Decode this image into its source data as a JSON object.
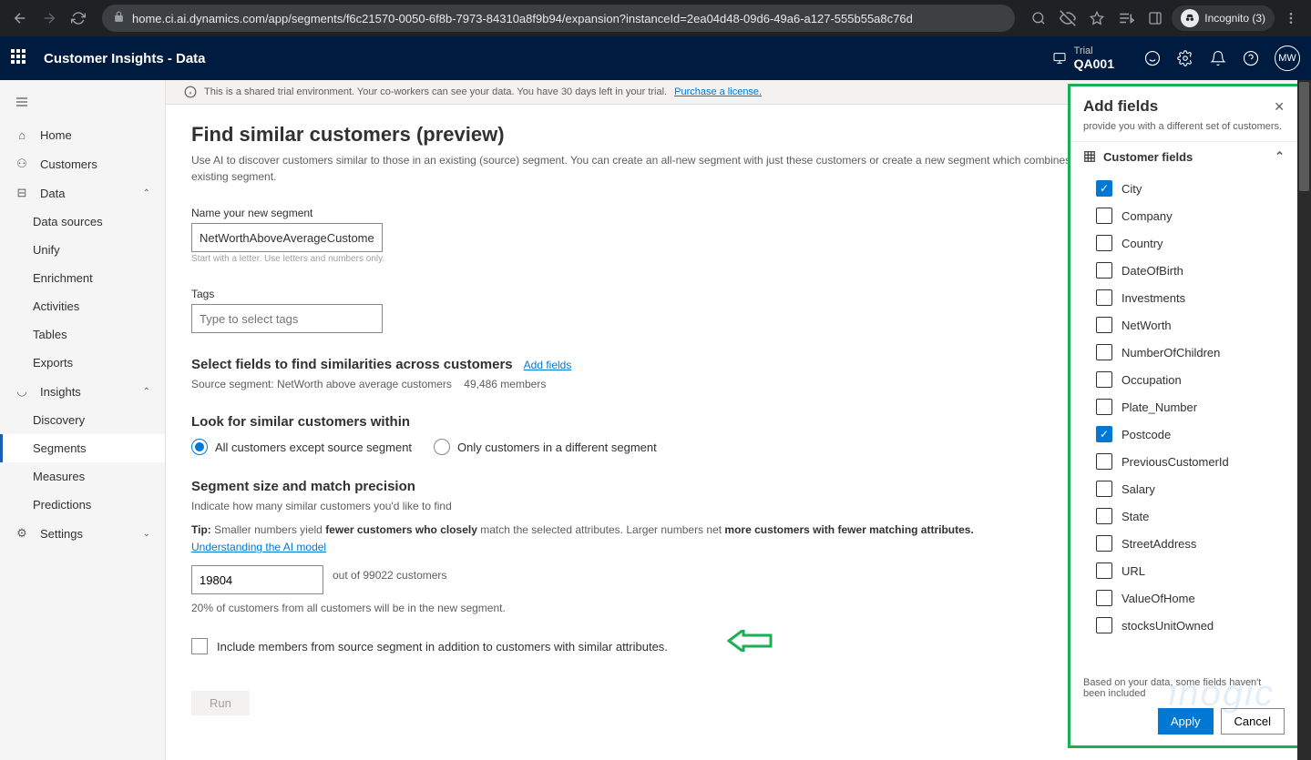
{
  "browser": {
    "url": "home.ci.ai.dynamics.com/app/segments/f6c21570-0050-6f8b-7973-84310a8f9b94/expansion?instanceId=2ea04d48-09d6-49a6-a127-555b55a8c76d",
    "incognito": "Incognito (3)"
  },
  "header": {
    "title": "Customer Insights - Data",
    "trial_label": "Trial",
    "trial_env": "QA001",
    "avatar": "MW"
  },
  "nav": {
    "home": "Home",
    "customers": "Customers",
    "data": "Data",
    "data_sources": "Data sources",
    "unify": "Unify",
    "enrichment": "Enrichment",
    "activities": "Activities",
    "tables": "Tables",
    "exports": "Exports",
    "insights": "Insights",
    "discovery": "Discovery",
    "segments": "Segments",
    "measures": "Measures",
    "predictions": "Predictions",
    "settings": "Settings"
  },
  "banner": {
    "text": "This is a shared trial environment. Your co-workers can see your data. You have 30 days left in your trial.",
    "link": "Purchase a license."
  },
  "page": {
    "title": "Find similar customers (preview)",
    "desc": "Use AI to discover customers similar to those in an existing (source) segment. You can create an all-new segment with just these customers or create a new segment which combines newly discovered customers with the existing segment.",
    "name_label": "Name your new segment",
    "name_value": "NetWorthAboveAverageCustomersEx...",
    "name_hint": "Start with a letter. Use letters and numbers only.",
    "tags_label": "Tags",
    "tags_placeholder": "Type to select tags",
    "select_fields_title": "Select fields to find similarities across customers",
    "add_fields_link": "Add fields",
    "source_segment": "Source segment: NetWorth above average customers",
    "source_members": "49,486 members",
    "look_for_title": "Look for similar customers within",
    "radio1": "All customers except source segment",
    "radio2": "Only customers in a different segment",
    "size_title": "Segment size and match precision",
    "size_sub": "Indicate how many similar customers you'd like to find",
    "tip_label": "Tip:",
    "tip1": "Smaller numbers yield",
    "tip_b1": "fewer customers who closely",
    "tip2": "match the selected attributes. Larger numbers net",
    "tip_b2": "more customers with fewer matching attributes.",
    "tip_link": "Understanding the AI model",
    "size_value": "19804",
    "size_suffix": "out of 99022 customers",
    "size_pct": "20% of customers from all customers will be in the new segment.",
    "include_label": "Include members from source segment in addition to customers with similar attributes.",
    "run": "Run"
  },
  "panel": {
    "title": "Add fields",
    "note": "provide you with a different set of customers.",
    "section": "Customer fields",
    "fields": [
      {
        "label": "City",
        "checked": true
      },
      {
        "label": "Company",
        "checked": false
      },
      {
        "label": "Country",
        "checked": false
      },
      {
        "label": "DateOfBirth",
        "checked": false
      },
      {
        "label": "Investments",
        "checked": false
      },
      {
        "label": "NetWorth",
        "checked": false
      },
      {
        "label": "NumberOfChildren",
        "checked": false
      },
      {
        "label": "Occupation",
        "checked": false
      },
      {
        "label": "Plate_Number",
        "checked": false
      },
      {
        "label": "Postcode",
        "checked": true
      },
      {
        "label": "PreviousCustomerId",
        "checked": false
      },
      {
        "label": "Salary",
        "checked": false
      },
      {
        "label": "State",
        "checked": false
      },
      {
        "label": "StreetAddress",
        "checked": false
      },
      {
        "label": "URL",
        "checked": false
      },
      {
        "label": "ValueOfHome",
        "checked": false
      },
      {
        "label": "stocksUnitOwned",
        "checked": false
      }
    ],
    "foot_note": "Based on your data, some fields haven't been included",
    "apply": "Apply",
    "cancel": "Cancel"
  },
  "watermark": "inogic"
}
